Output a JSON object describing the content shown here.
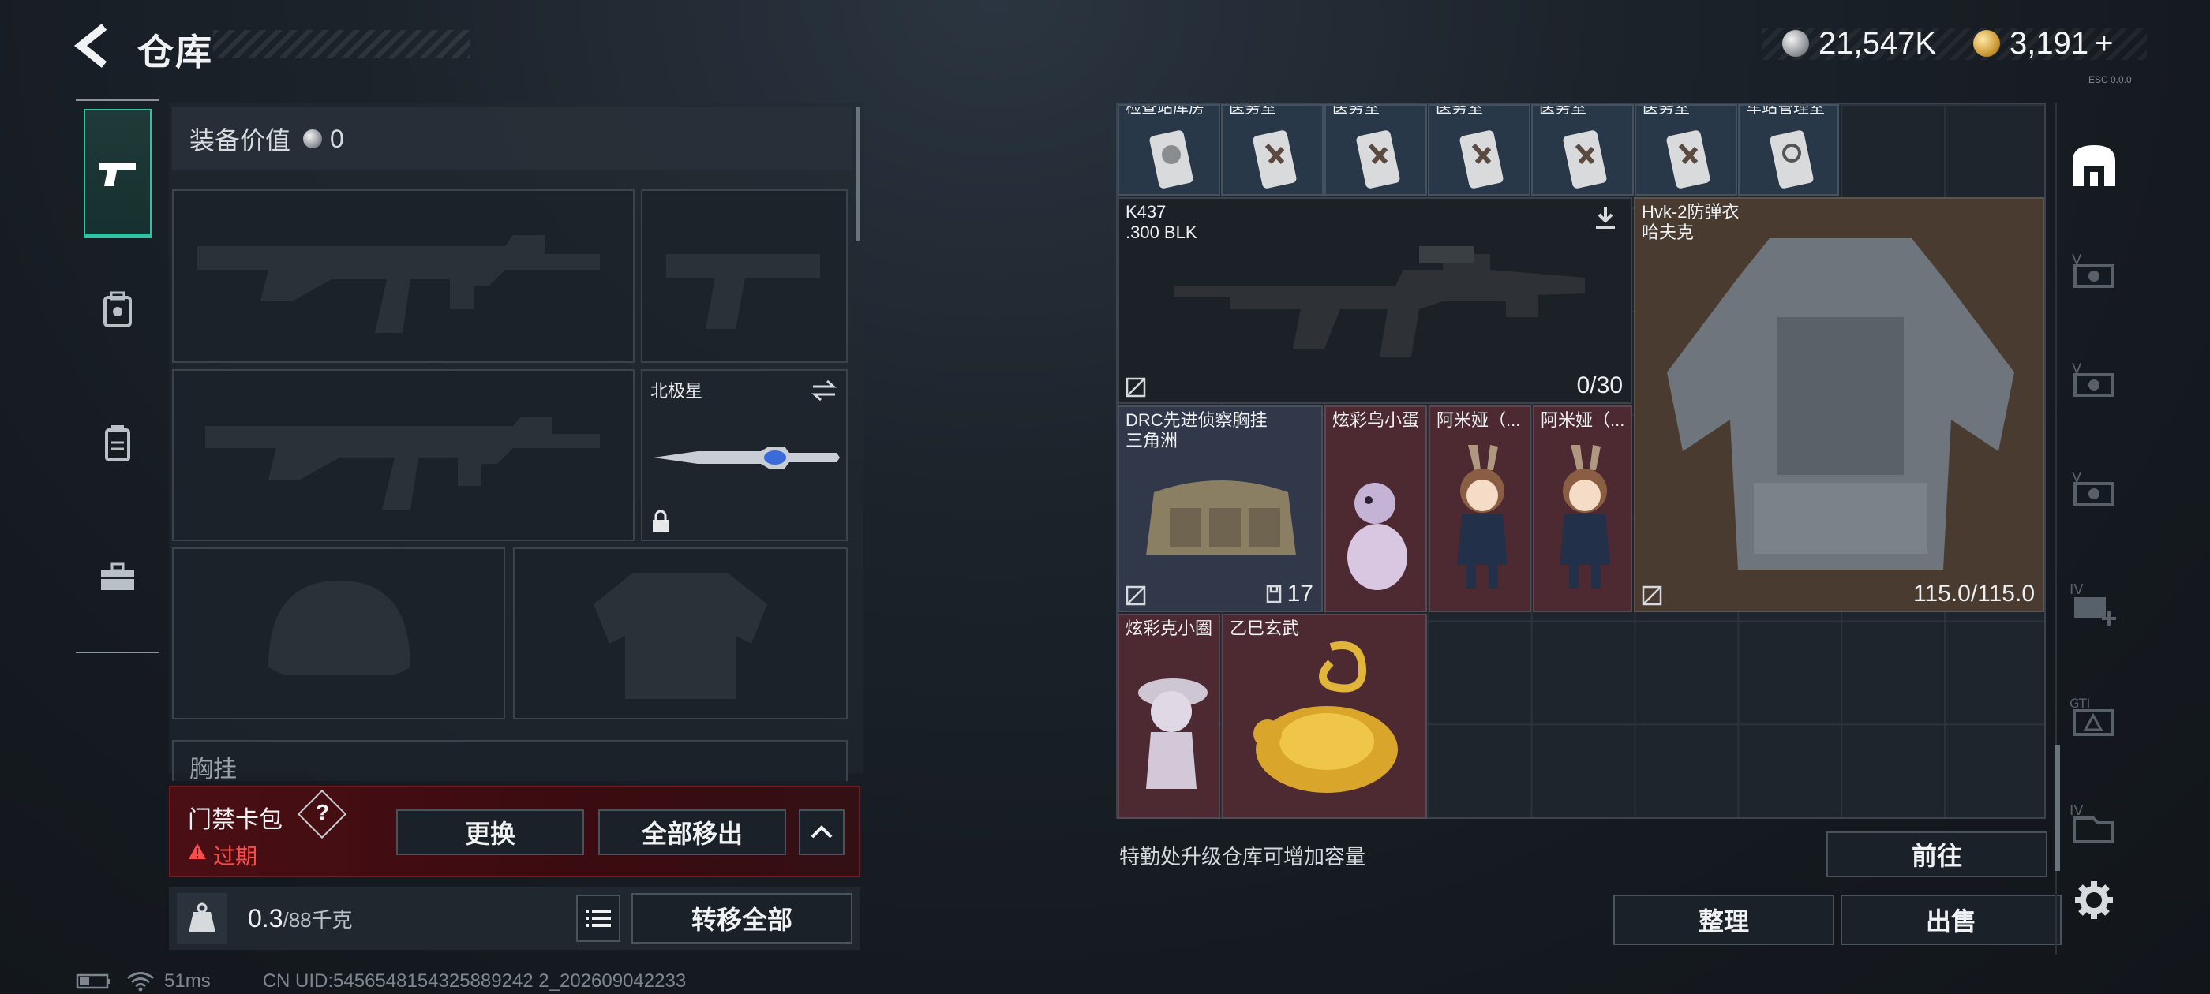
{
  "header": {
    "title": "仓库"
  },
  "currency": {
    "silver": "21,547K",
    "gold": "3,191",
    "gold_plus": "+"
  },
  "version_tiny": "ESC 0.0.0",
  "left_tabs": [
    "weapons",
    "backpack",
    "chest-rig",
    "case"
  ],
  "equipment": {
    "value_label": "装备价值",
    "value": "0",
    "melee_name": "北极星",
    "chest_label": "胸挂"
  },
  "card_bag": {
    "title": "门禁卡包",
    "help": "?",
    "status": "过期",
    "btn_replace": "更换",
    "btn_remove_all": "全部移出"
  },
  "weight": {
    "current": "0.3",
    "max": "/88千克",
    "transfer_all": "转移全部"
  },
  "storage": {
    "top_row": [
      "检查站库房",
      "医务室",
      "医务室",
      "医务室",
      "医务室",
      "医务室",
      "车站管理室"
    ],
    "items": {
      "k437_name": "K437",
      "k437_ammo": ".300 BLK",
      "k437_count": "0/30",
      "armor_name": "Hvk-2防弹衣",
      "armor_sub": "哈夫克",
      "armor_durability": "115.0/115.0",
      "rig_name": "DRC先进侦察胸挂",
      "rig_sub": "三角洲",
      "rig_count": "17",
      "egg_name": "炫彩乌小蛋",
      "amiya1_name": "阿米娅（...",
      "amiya2_name": "阿米娅（...",
      "circle_name": "炫彩克小圈",
      "gold_name": "乙巳玄武"
    },
    "hint": "特勤处升级仓库可增加容量",
    "goto": "前往",
    "sort": "整理",
    "sell": "出售"
  },
  "status_bar": {
    "ping": "51ms",
    "uid": "CN UID:5456548154325889242 2_202609042233"
  }
}
